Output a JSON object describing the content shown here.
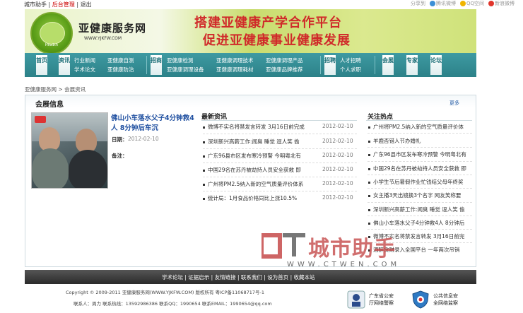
{
  "topbar": {
    "helper": "城市助手",
    "admin": "后台管理",
    "sep1": "|",
    "sep2": "|",
    "logout": "退出",
    "share_label": "分享到",
    "share1": "腾讯微博",
    "share2": "QQ空间",
    "share3": "新浪微博"
  },
  "banner": {
    "site_name": "亚健康服务网",
    "site_url": "WWW.YJKFW.COM",
    "logo_text": "Hea1th",
    "slogan1": "搭建亚健康产学合作平台",
    "slogan2": "促进亚健康事业健康发展"
  },
  "nav": {
    "home": "首页",
    "info": "资讯",
    "info_links": [
      "行业新闻",
      "亚健康自测",
      "学术论文",
      "亚健康防治"
    ],
    "invest": "招商",
    "invest_links": [
      "亚健康检测",
      "亚健康调理技术",
      "亚健康调理产品",
      "亚健康调理设备",
      "亚健康调理耗材",
      "亚健康品牌推荐"
    ],
    "jobs": "招聘",
    "jobs_links": [
      "人才招聘",
      "个人求职"
    ],
    "expo": "会展",
    "expert": "专家",
    "forum": "论坛"
  },
  "breadcrumb": {
    "home": "亚健康服务网",
    "sep": ">",
    "current": "会展资讯"
  },
  "section": {
    "title": "会展信息",
    "more": "更多"
  },
  "featured": {
    "title": "佛山小车落水父子4分钟救4人 8分钟后车沉",
    "date_label": "日期：",
    "date": "2012-02-10",
    "note_label": "备注："
  },
  "latest": {
    "heading": "最新资讯",
    "items": [
      {
        "title": "微博不实名将禁发言转发 3月16日前完成",
        "date": "2012-02-10"
      },
      {
        "title": "深圳新兴高薪工作:闻臭 睡觉 逗人笑 偷",
        "date": "2012-02-10"
      },
      {
        "title": "广东96县市区发布寒冷预警 今明粤北有",
        "date": "2012-02-10"
      },
      {
        "title": "中国29名在苏丹被劫持人员安全获救 即",
        "date": "2012-02-10"
      },
      {
        "title": "广州将PM2.5纳入新的空气质量评价体系",
        "date": "2012-02-10"
      },
      {
        "title": "统计局：1月食品价格同比上涨10.5%",
        "date": "2012-02-10"
      }
    ]
  },
  "hot": {
    "heading": "关注热点",
    "items": [
      "广州将PM2.5纳入新的空气质量评价体",
      "羊鹿否错人节办婚礼",
      "广东96县市区发布寒冷预警 今明粤北有",
      "中国29名在苏丹被劫持人员安全获救 即",
      "小学生节后暑假作业忙钱结父母年终奖",
      "女主播3天出镜换3个名字 网友笑称要",
      "深圳新兴高薪工作:闻臭 睡觉 逗人笑 偷",
      "佛山小车落水父子4分钟救4人 8分钟后",
      "微博不实名将禁发言转发 3月16日前完",
      "酒醉贪财录入全国平台 一年两次吊销"
    ]
  },
  "watermark": {
    "brand": "城市助手",
    "url": "WWW.CTWEN.COM"
  },
  "footer": {
    "links": [
      "学术论坛",
      "证据启示",
      "友情链接",
      "联系我们",
      "设为首页",
      "收藏本站"
    ],
    "copyright": "Copyright © 2009-2011  亚健康服务网(WWW.YJKFW.COM) 版权所有  粤ICP备11068717号-1",
    "contact": "联系人：周力   联系热线：13592986386   联系QQ：1990654   联系EMAIL：1990654@qq.com",
    "badge1": [
      "广东省公安",
      "厅网络警察"
    ],
    "badge2": [
      "公共信息安",
      "全网络监察"
    ]
  },
  "colors": {
    "nav_teal": "#2f8a91",
    "slogan_red": "#d02a2a",
    "link_blue": "#1f4fa0",
    "footer_dark": "#333333"
  }
}
